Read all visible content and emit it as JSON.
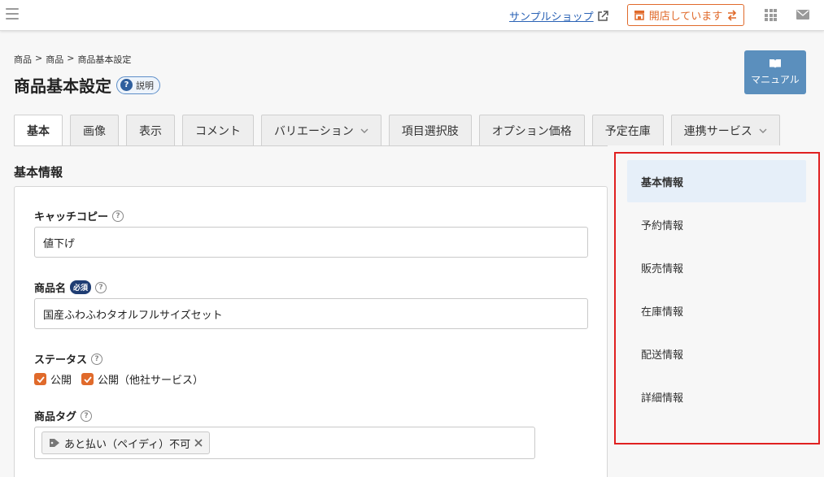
{
  "topbar": {
    "shop_link": "サンプルショップ",
    "open_status": "開店しています",
    "colors": {
      "accent": "#e06a2b",
      "link": "#2a62b5"
    }
  },
  "header": {
    "breadcrumb": [
      "商品",
      "商品",
      "商品基本設定"
    ],
    "breadcrumb_sep": ">",
    "title": "商品基本設定",
    "help_label": "説明",
    "manual_label": "マニュアル"
  },
  "tabs": [
    {
      "label": "基本",
      "active": true
    },
    {
      "label": "画像"
    },
    {
      "label": "表示"
    },
    {
      "label": "コメント"
    },
    {
      "label": "バリエーション",
      "dropdown": true
    },
    {
      "label": "項目選択肢"
    },
    {
      "label": "オプション価格"
    },
    {
      "label": "予定在庫"
    },
    {
      "label": "連携サービス",
      "dropdown": true
    }
  ],
  "form": {
    "section_title": "基本情報",
    "catch_copy": {
      "label": "キャッチコピー",
      "value": "値下げ"
    },
    "product_name": {
      "label": "商品名",
      "required_badge": "必須",
      "value": "国産ふわふわタオルフルサイズセット"
    },
    "status": {
      "label": "ステータス",
      "options": [
        "公開",
        "公開（他社サービス）"
      ]
    },
    "product_tag": {
      "label": "商品タグ",
      "tags": [
        "あと払い（ペイディ）不可"
      ]
    }
  },
  "side_nav": {
    "items": [
      "基本情報",
      "予約情報",
      "販売情報",
      "在庫情報",
      "配送情報",
      "詳細情報"
    ],
    "active_index": 0,
    "highlight_color": "#e02020"
  }
}
